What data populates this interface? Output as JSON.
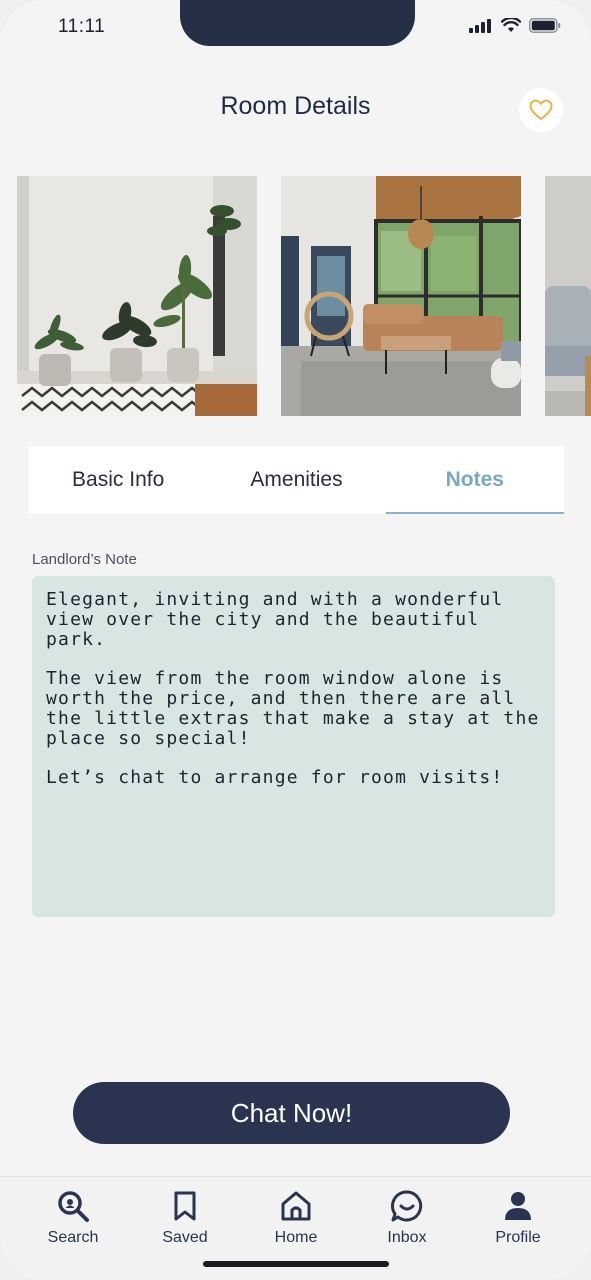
{
  "status_bar": {
    "time": "11:11"
  },
  "header": {
    "title": "Room Details"
  },
  "photos": [
    {
      "name": "living-room-plants-photo"
    },
    {
      "name": "sunroom-lounge-photo"
    },
    {
      "name": "sofa-partial-photo"
    }
  ],
  "tabs": [
    {
      "label": "Basic Info",
      "active": false
    },
    {
      "label": "Amenities",
      "active": false
    },
    {
      "label": "Notes",
      "active": true
    }
  ],
  "note": {
    "label": "Landlord’s Note",
    "paragraphs": [
      "Elegant, inviting and with a wonderful view over the city and the beautiful park.",
      "The view from the room window alone is worth the price, and then there are all the little extras that make a stay at the place so special!",
      "Let’s chat to arrange for room visits!"
    ]
  },
  "cta": {
    "label": "Chat Now!"
  },
  "nav": [
    {
      "label": "Search",
      "icon": "search-icon"
    },
    {
      "label": "Saved",
      "icon": "bookmark-icon"
    },
    {
      "label": "Home",
      "icon": "home-icon"
    },
    {
      "label": "Inbox",
      "icon": "chat-bubble-icon"
    },
    {
      "label": "Profile",
      "icon": "user-icon"
    }
  ],
  "colors": {
    "primary": "#2a3450",
    "accent_tab": "#7aa7c2",
    "note_bg": "#d8e6e3",
    "heart": "#e8b44a"
  }
}
